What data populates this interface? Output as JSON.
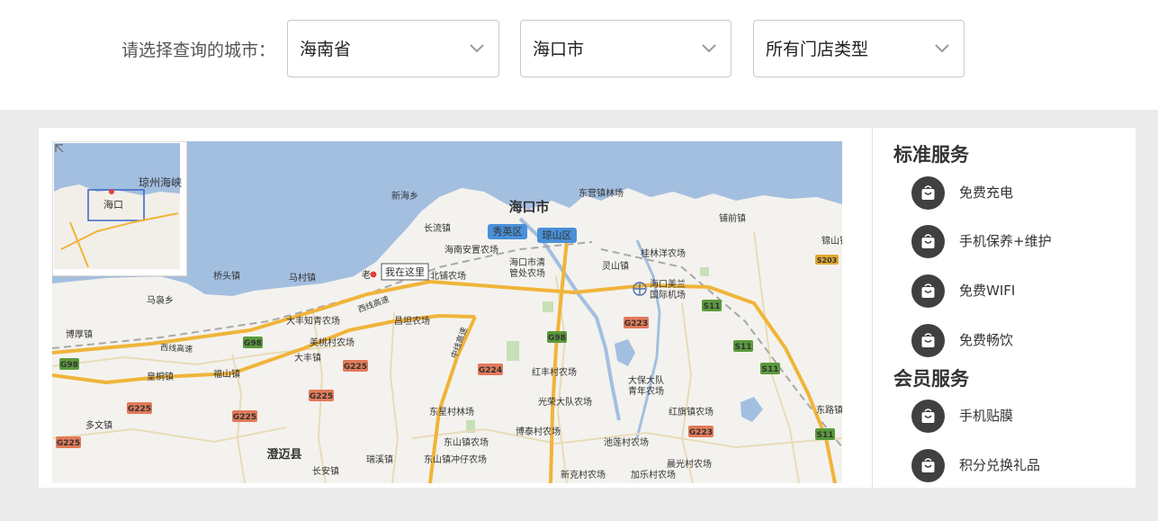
{
  "filter": {
    "label": "请选择查询的城市：",
    "province": "海南省",
    "city": "海口市",
    "store_type": "所有门店类型"
  },
  "map": {
    "places": {
      "haikou_city": "海口市",
      "xiuying": "秀英区",
      "qiongshan": "琼山区",
      "xinhai": "新海乡",
      "changliu": "长流镇",
      "dongying_linchang": "东营镇林场",
      "puqian": "铺前镇",
      "jinshan": "锦山镇",
      "haikou_anzhi": "海南安置农场",
      "haikou_qing1": "海口市清",
      "haikou_qing2": "管处农场",
      "guilinyang": "桂林洋农场",
      "qiaotou": "桥头镇",
      "macun": "马村镇",
      "laocheng": "老",
      "you_are_here": "我在这里",
      "beipu": "北铺农场",
      "lingshan": "灵山镇",
      "airport1": "海口美兰",
      "airport2": "国际机场",
      "maniao": "马袅乡",
      "dafeng_zhiqing": "大丰知青农场",
      "changpo": "昌坦农场",
      "bohou": "博厚镇",
      "meitaocun": "美桃村农场",
      "dafeng": "大丰镇",
      "huangtong": "皇桐镇",
      "fushan": "福山镇",
      "hongfeng": "红丰村农场",
      "dabao1": "大保大队",
      "dabao2": "青年农场",
      "hongqi": "红旗镇农场",
      "guangrong": "光荣大队农场",
      "dongxing": "东星村林场",
      "duowen": "多文镇",
      "dongshan": "东山镇农场",
      "botai": "博泰村农场",
      "chilian": "池莲村农场",
      "chengmai": "澄迈县",
      "ruixi": "瑞溪镇",
      "dongshan_chongzai": "东山镇冲仔农场",
      "changan": "长安镇",
      "xinke": "新克村农场",
      "jiale": "加乐村农场",
      "chengguang": "晨光村农场",
      "dongluo": "东路镇",
      "west_expy1": "西线高速",
      "west_expy2": "西线高速",
      "middle_expy": "中线高速",
      "inset_haikou": "海口",
      "inset_strait": "琼州海峡"
    },
    "shields": {
      "g98": "G98",
      "g225": "G225",
      "g224": "G224",
      "g223": "G223",
      "s11": "S11",
      "s203": "S203"
    }
  },
  "services": {
    "standard_title": "标准服务",
    "standard": [
      {
        "label": "免费充电"
      },
      {
        "label": "手机保养+维护"
      },
      {
        "label": "免费WIFI"
      },
      {
        "label": "免费畅饮"
      }
    ],
    "member_title": "会员服务",
    "member": [
      {
        "label": "手机贴膜"
      },
      {
        "label": "积分兑换礼品"
      }
    ]
  }
}
